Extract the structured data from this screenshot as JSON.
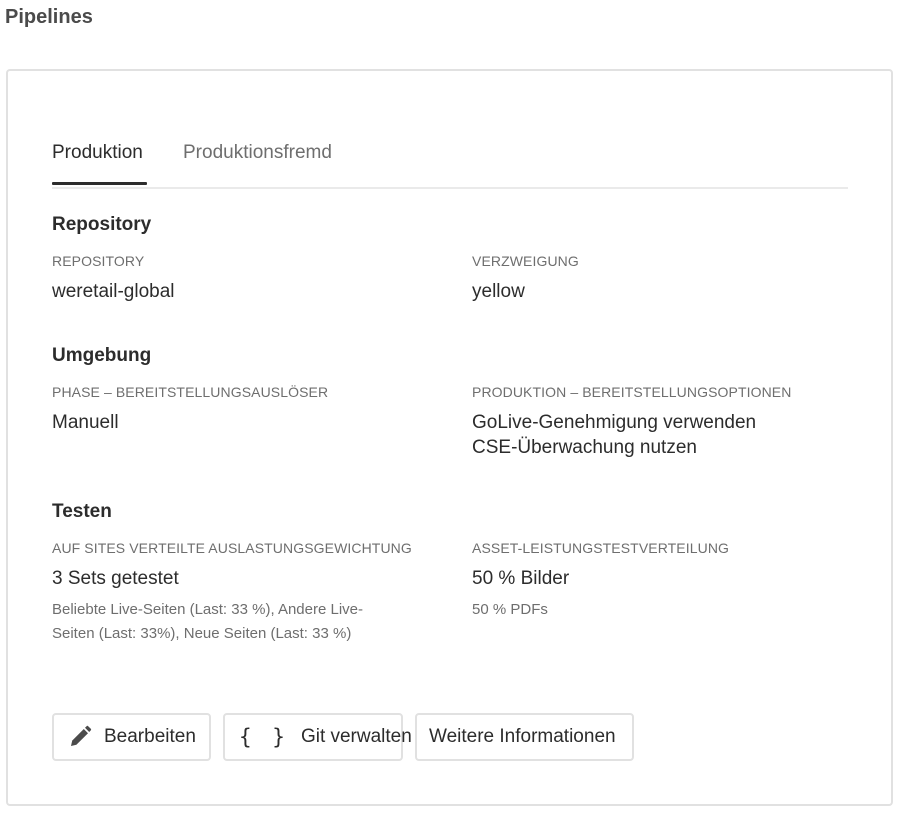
{
  "page": {
    "title": "Pipelines"
  },
  "tabs": [
    {
      "label": "Produktion",
      "active": true
    },
    {
      "label": "Produktionsfremd",
      "active": false
    }
  ],
  "repository": {
    "title": "Repository",
    "repo_label": "REPOSITORY",
    "repo_value": "weretail-global",
    "branch_label": "VERZWEIGUNG",
    "branch_value": "yellow"
  },
  "environment": {
    "title": "Umgebung",
    "trigger_label": "PHASE – BEREITSTELLUNGSAUSLÖSER",
    "trigger_value": "Manuell",
    "options_label": "PRODUKTION – BEREITSTELLUNGSOPTIONEN",
    "options_values": [
      "GoLive-Genehmigung verwenden",
      "CSE-Überwachung nutzen"
    ]
  },
  "testing": {
    "title": "Testen",
    "load_label": "AUF SITES VERTEILTE AUSLASTUNGSGEWICHTUNG",
    "load_value": "3 Sets getestet",
    "load_detail_lines": [
      "Beliebte Live-Seiten (Last: 33 %), Andere Live-",
      "Seiten (Last: 33%), Neue Seiten (Last: 33 %)"
    ],
    "asset_label": "ASSET-LEISTUNGSTESTVERTEILUNG",
    "asset_value": "50 % Bilder",
    "asset_detail": "50 % PDFs"
  },
  "actions": {
    "edit_label": "Bearbeiten",
    "edit_icon": "pencil-icon",
    "git_label": "Git verwalten",
    "git_icon": "braces-icon",
    "git_icon_glyph": "{ }",
    "info_label": "Weitere Informationen"
  }
}
